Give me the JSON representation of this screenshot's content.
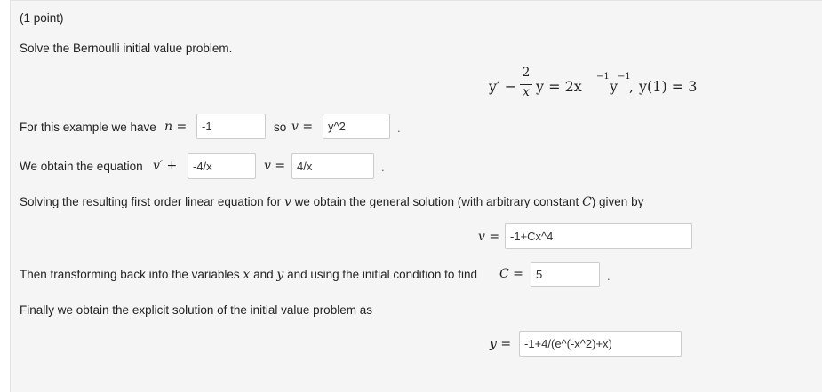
{
  "points_label": "(1 point)",
  "prompt": "Solve the Bernoulli initial value problem.",
  "equation": {
    "lhs_prime": "y′ −",
    "frac_num": "2",
    "frac_den": "x",
    "after_frac": "y = 2x",
    "exp1": "−1",
    "y_part": "y",
    "exp2": "−1",
    "comma": ",",
    "initial": "y(1) = 3"
  },
  "line1": {
    "text_before": "For this example we have",
    "n_label": "n =",
    "n_value": "-1",
    "so_text": "so",
    "v_label": "v =",
    "v_value": "y^2",
    "period": "."
  },
  "line2": {
    "text_before": "We obtain the equation",
    "vprime_label": "v′ +",
    "coef_value": "-4/x",
    "v_label": "v =",
    "rhs_value": "4/x",
    "period": "."
  },
  "line3": {
    "text_a": "Solving the resulting first order linear equation for",
    "var_v": "v",
    "text_b": "we obtain the general solution (with arbitrary constant",
    "var_C": "C",
    "text_c": ") given by"
  },
  "general_solution": {
    "v_label": "v =",
    "value": "-1+Cx^4"
  },
  "line4": {
    "text_a": "Then transforming back into the variables",
    "var_x": "x",
    "text_and": "and",
    "var_y": "y",
    "text_b": "and using the initial condition to find",
    "C_label": "C =",
    "C_value": "5",
    "period": "."
  },
  "line5": {
    "text": "Finally we obtain the explicit solution of the initial value problem as"
  },
  "explicit_solution": {
    "y_label": "y =",
    "value": "-1+4/(e^(-x^2)+x)"
  }
}
